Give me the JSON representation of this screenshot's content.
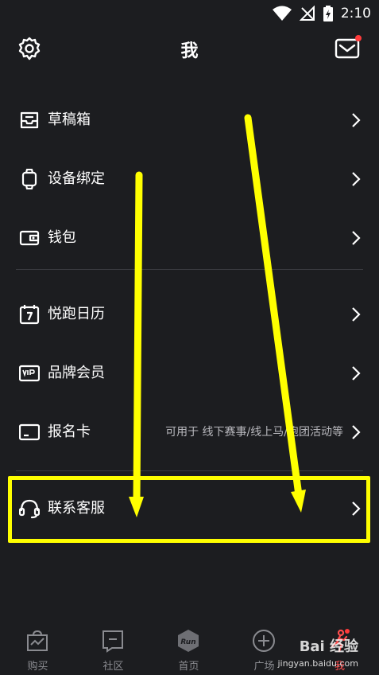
{
  "status_bar": {
    "time": "2:10"
  },
  "header": {
    "title": "我"
  },
  "menu": [
    {
      "label": "草稿箱",
      "hint": ""
    },
    {
      "label": "设备绑定",
      "hint": ""
    },
    {
      "label": "钱包",
      "hint": ""
    },
    {
      "label": "悦跑日历",
      "hint": ""
    },
    {
      "label": "品牌会员",
      "hint": ""
    },
    {
      "label": "报名卡",
      "hint": "可用于 线下赛事/线上马/跑团活动等"
    },
    {
      "label": "联系客服",
      "hint": ""
    }
  ],
  "bottom_nav": [
    {
      "label": "购买"
    },
    {
      "label": "社区"
    },
    {
      "label": "首页",
      "logo_text": "Run"
    },
    {
      "label": "广场"
    },
    {
      "label": "我"
    }
  ],
  "watermark": {
    "brand": "Bai 经验",
    "url": "jingyan.baidu.com"
  },
  "colors": {
    "background": "#1c1d20",
    "highlight": "#ffff00",
    "accent": "#ff3b3b"
  }
}
